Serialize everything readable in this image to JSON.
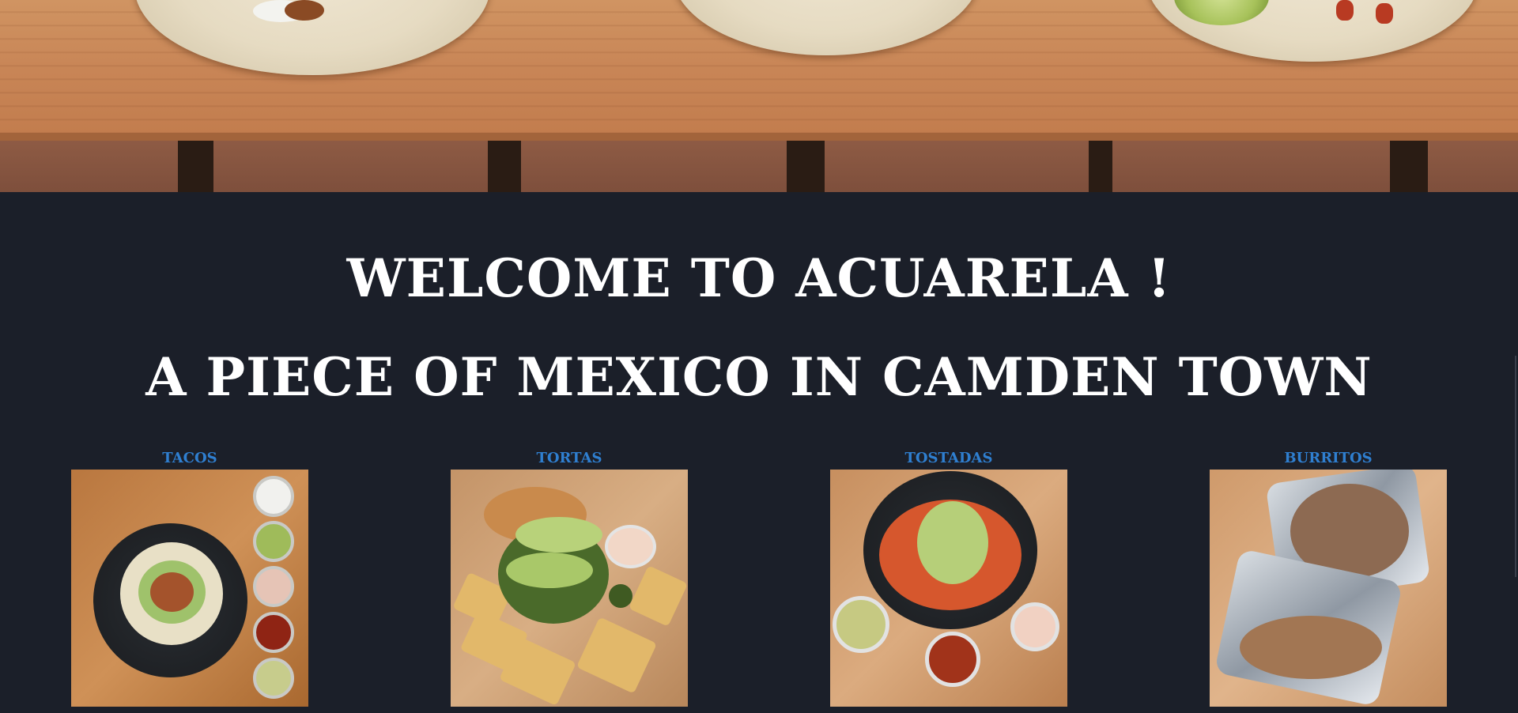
{
  "welcome": {
    "line1": "WELCOME TO ACUARELA !",
    "line2": "A PIECE OF MEXICO IN CAMDEN TOWN"
  },
  "menu": {
    "items": [
      {
        "label": "TACOS"
      },
      {
        "label": "TORTAS"
      },
      {
        "label": "TOSTADAS"
      },
      {
        "label": "BURRITOS"
      }
    ]
  },
  "colors": {
    "background": "#1b1f29",
    "heading": "#ffffff",
    "category_link": "#2f7fd0"
  }
}
